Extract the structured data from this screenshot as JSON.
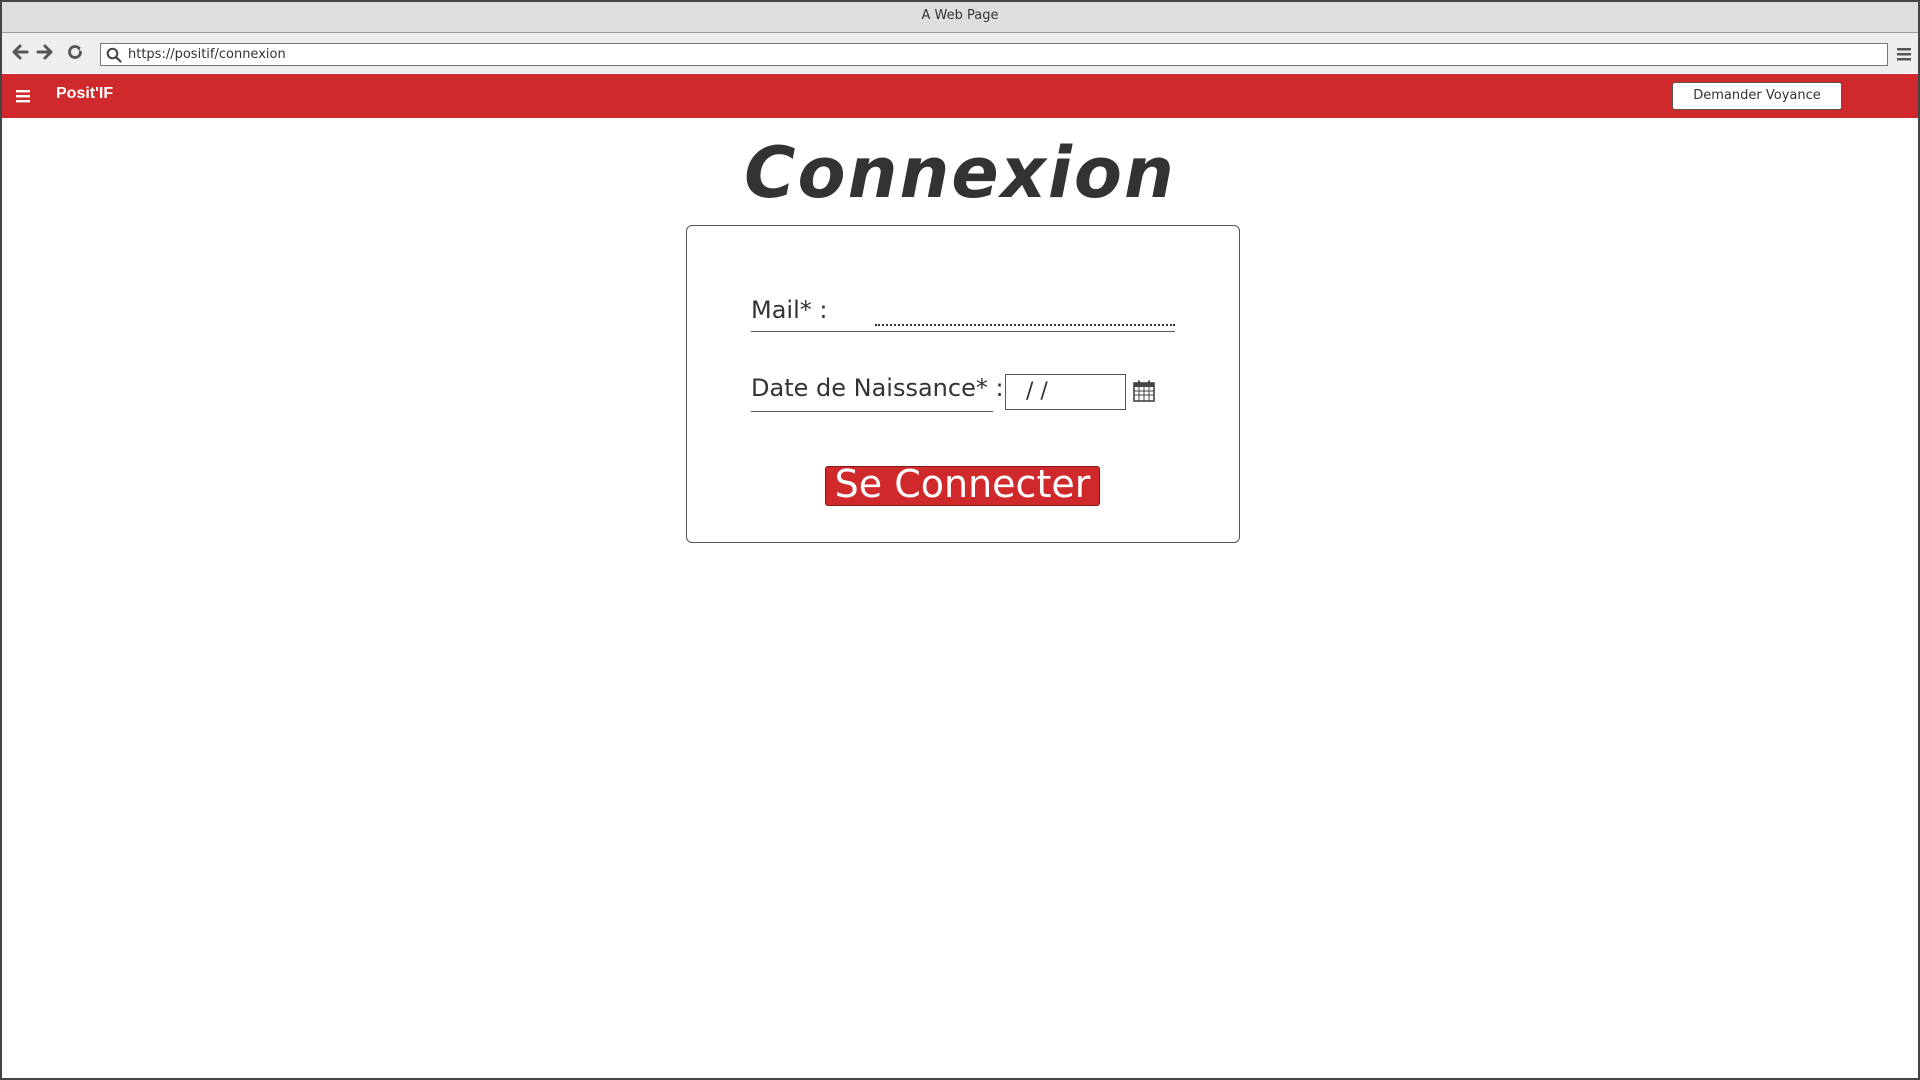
{
  "window": {
    "title": "A Web Page",
    "address": "https://positif/connexion"
  },
  "header": {
    "brand": "Posit'IF",
    "action_label": "Demander Voyance",
    "color": "#d0292b"
  },
  "page": {
    "title": "Connexion"
  },
  "form": {
    "mail_label": "Mail* :",
    "mail_value": "",
    "birthdate_label": "Date de Naissance* :",
    "birthdate_value": " /  /",
    "submit_label": "Se Connecter"
  },
  "icons": {
    "back": "arrow-left-icon",
    "forward": "arrow-right-icon",
    "reload": "reload-icon",
    "search": "search-icon",
    "browser_menu": "menu-icon",
    "app_menu": "hamburger-icon",
    "date_picker": "calendar-icon"
  }
}
